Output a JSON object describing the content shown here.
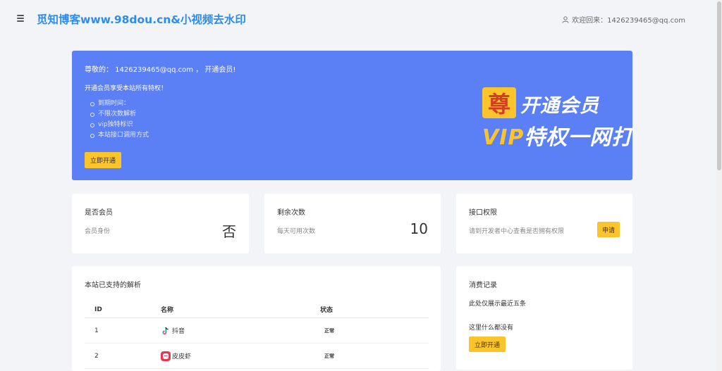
{
  "header": {
    "site_title": "觅知博客www.98dou.cn&小视频去水印",
    "welcome_text": "欢迎回来：1426239465@qq.com"
  },
  "banner": {
    "greeting": "尊敬的： 1426239465@qq.com ， 开通会员!",
    "perks_title": "开通会员享受本站所有特权！",
    "perks": [
      "到期时间：",
      "不限次数解析",
      "vip独特标识",
      "本站接口调用方式"
    ],
    "open_button": "立即开通",
    "promo": {
      "badge": "尊",
      "line1": "开通会员",
      "line2_vip": "VIP",
      "line2_rest": "特权一网打尽!"
    }
  },
  "stats": {
    "member": {
      "title": "是否会员",
      "subtitle": "会员身份",
      "value": "否"
    },
    "remaining": {
      "title": "剩余次数",
      "subtitle": "每天可用次数",
      "value": "10"
    },
    "api": {
      "title": "接口权限",
      "subtitle": "请到开发者中心查看是否拥有权限",
      "button": "申请"
    }
  },
  "supported": {
    "title": "本站已支持的解析",
    "columns": [
      "ID",
      "名称",
      "状态"
    ],
    "rows": [
      {
        "id": "1",
        "name": "抖音",
        "icon": "douyin-icon",
        "status": "正常"
      },
      {
        "id": "2",
        "name": "皮皮虾",
        "icon": "pipixia-icon",
        "status": "正常"
      }
    ]
  },
  "records": {
    "title": "消费记录",
    "note": "此处仅展示最近五条",
    "empty": "这里什么都没有",
    "button": "立即开通"
  },
  "colors": {
    "brand_blue": "#2d8cf0",
    "banner_blue": "#5b7ff5",
    "button_yellow": "#fcc42b"
  }
}
